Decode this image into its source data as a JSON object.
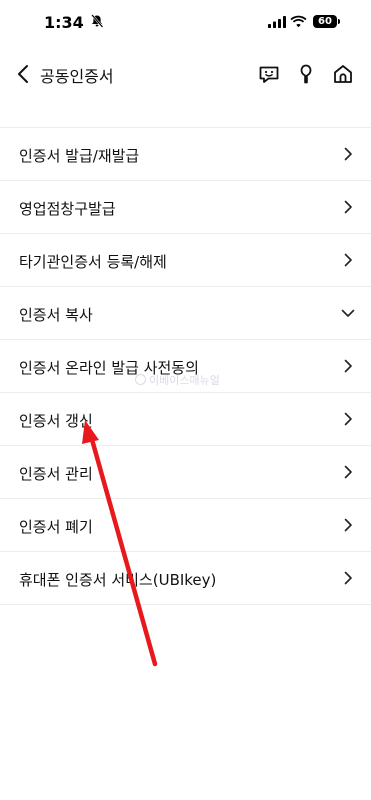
{
  "status_bar": {
    "time": "1:34",
    "battery": "60"
  },
  "header": {
    "title": "공동인증서"
  },
  "menu": {
    "items": [
      {
        "label": "인증서 발급/재발급",
        "chevron": "chevron-right"
      },
      {
        "label": "영업점창구발급",
        "chevron": "chevron-right"
      },
      {
        "label": "타기관인증서 등록/해제",
        "chevron": "chevron-right"
      },
      {
        "label": "인증서 복사",
        "chevron": "chevron-down"
      },
      {
        "label": "인증서 온라인 발급 사전동의",
        "chevron": "chevron-right"
      },
      {
        "label": "인증서 갱신",
        "chevron": "chevron-right"
      },
      {
        "label": "인증서 관리",
        "chevron": "chevron-right"
      },
      {
        "label": "인증서 폐기",
        "chevron": "chevron-right"
      },
      {
        "label": "휴대폰 인증서 서비스(UBIkey)",
        "chevron": "chevron-right"
      }
    ]
  },
  "watermark": "이베이스매뉴얼",
  "colors": {
    "annotation_arrow": "#e8191c",
    "divider": "#ececec"
  }
}
